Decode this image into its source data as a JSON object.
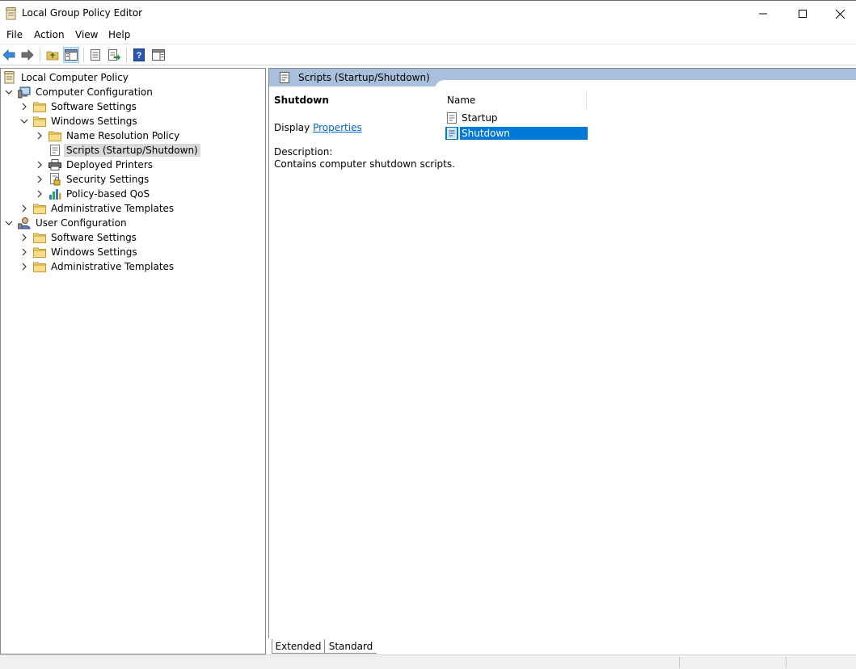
{
  "window": {
    "title": "Local Group Policy Editor",
    "controls": [
      "minimize",
      "maximize",
      "close"
    ]
  },
  "menu": [
    "File",
    "Action",
    "View",
    "Help"
  ],
  "toolbar": {
    "buttons": [
      "back-arrow-icon",
      "forward-arrow-icon",
      "up-folder-icon",
      "show-hide-tree-icon",
      "properties-icon",
      "export-list-icon",
      "help-icon",
      "show-hide-action-pane-icon"
    ]
  },
  "tree": {
    "root": "Local Computer Policy",
    "computer_config": "Computer Configuration",
    "cc_software": "Software Settings",
    "cc_windows": "Windows Settings",
    "cc_name_resolution": "Name Resolution Policy",
    "cc_scripts": "Scripts (Startup/Shutdown)",
    "cc_printers": "Deployed Printers",
    "cc_security": "Security Settings",
    "cc_qos": "Policy-based QoS",
    "cc_admin": "Administrative Templates",
    "user_config": "User Configuration",
    "uc_software": "Software Settings",
    "uc_windows": "Windows Settings",
    "uc_admin": "Administrative Templates"
  },
  "details": {
    "header": "Scripts (Startup/Shutdown)",
    "item_title": "Shutdown",
    "display_prefix": "Display",
    "properties_link": "Properties",
    "description_label": "Description:",
    "description_text": "Contains computer shutdown scripts."
  },
  "list": {
    "column_name": "Name",
    "items": [
      "Startup",
      "Shutdown"
    ],
    "selected": "Shutdown"
  },
  "tabs": {
    "extended": "Extended",
    "standard": "Standard",
    "active": "Extended"
  },
  "colors": {
    "header_band": "#a9c0dc",
    "selection": "#0078d7",
    "link": "#0066cc",
    "tree_selection": "#d9d9d9"
  }
}
